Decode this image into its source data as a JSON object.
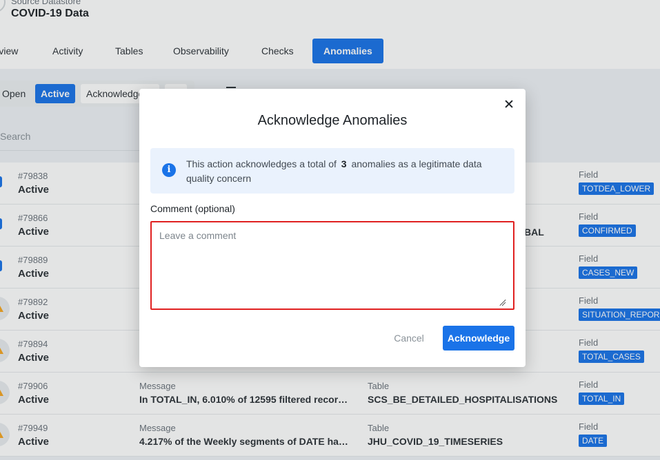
{
  "header": {
    "source_label": "Source Datastore",
    "title": "COVID-19 Data"
  },
  "tabs": [
    {
      "label": "Overview"
    },
    {
      "label": "Activity"
    },
    {
      "label": "Tables"
    },
    {
      "label": "Observability"
    },
    {
      "label": "Checks"
    },
    {
      "label": "Anomalies"
    }
  ],
  "filters": {
    "open": "Open",
    "active": "Active",
    "acknowledged": "Acknowledged"
  },
  "search": {
    "placeholder": "Search"
  },
  "list": {
    "message_label": "Message",
    "table_label": "Table",
    "field_label": "Field",
    "rows": [
      {
        "id": "#79838",
        "status": "Active",
        "message": "",
        "table": "",
        "field": "TOTDEA_LOWER",
        "marker": "blue"
      },
      {
        "id": "#79866",
        "status": "Active",
        "message": "",
        "table": "BAL",
        "field": "CONFIRMED",
        "marker": "blue"
      },
      {
        "id": "#79889",
        "status": "Active",
        "message": "",
        "table": "",
        "field": "CASES_NEW",
        "marker": "blue"
      },
      {
        "id": "#79892",
        "status": "Active",
        "message": "",
        "table": "",
        "field": "SITUATION_REPOR",
        "marker": "warn"
      },
      {
        "id": "#79894",
        "status": "Active",
        "message": "",
        "table": "",
        "field": "TOTAL_CASES",
        "marker": "warn"
      },
      {
        "id": "#79906",
        "status": "Active",
        "message": "In TOTAL_IN, 6.010% of 12595 filtered records...",
        "table": "SCS_BE_DETAILED_HOSPITALISATIONS",
        "field": "TOTAL_IN",
        "marker": "warn"
      },
      {
        "id": "#79949",
        "status": "Active",
        "message": "4.217% of the Weekly segments of DATE have ...",
        "table": "JHU_COVID_19_TIMESERIES",
        "field": "DATE",
        "marker": "warn"
      }
    ]
  },
  "modal": {
    "title": "Acknowledge Anomalies",
    "info_prefix": "This action acknowledges a total of",
    "info_count": "3",
    "info_suffix": "anomalies as a legitimate data quality concern",
    "comment_label": "Comment (optional)",
    "comment_placeholder": "Leave a comment",
    "comment_value": "",
    "cancel_label": "Cancel",
    "acknowledge_label": "Acknowledge"
  },
  "colors": {
    "accent": "#1a73e8",
    "highlight_border": "#e02020",
    "warning": "#f5a623"
  }
}
